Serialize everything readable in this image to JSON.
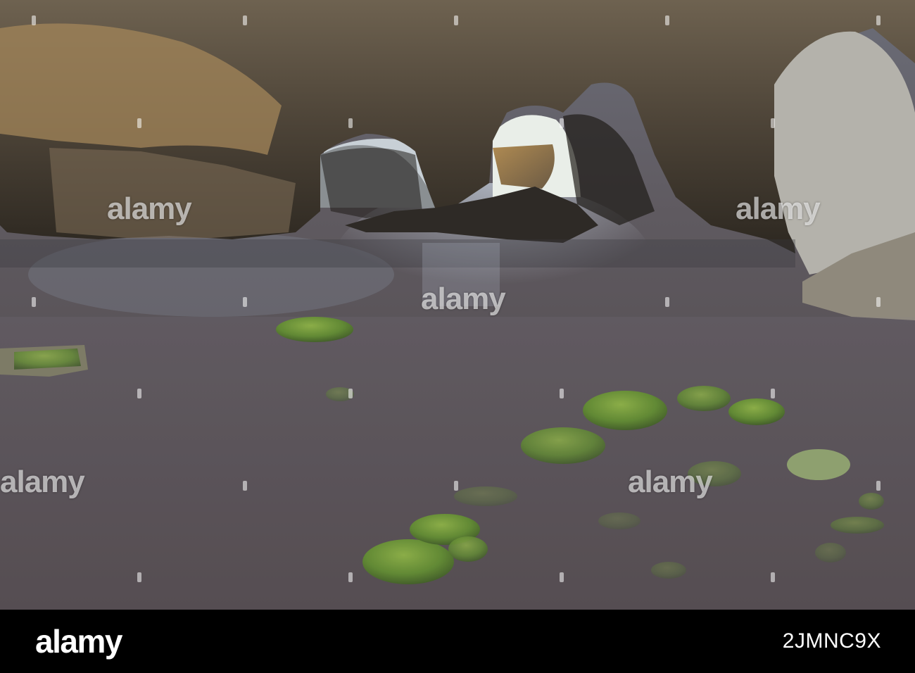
{
  "photo": {
    "subject": "",
    "watermark_text": "alamy",
    "colors": {
      "water": "#5e5a5e",
      "rock": "#4a4236",
      "moss": "#5f8a2c",
      "sky": "#e8ece8"
    }
  },
  "footer": {
    "brand": "alamy",
    "image_id": "2JMNC9X"
  }
}
